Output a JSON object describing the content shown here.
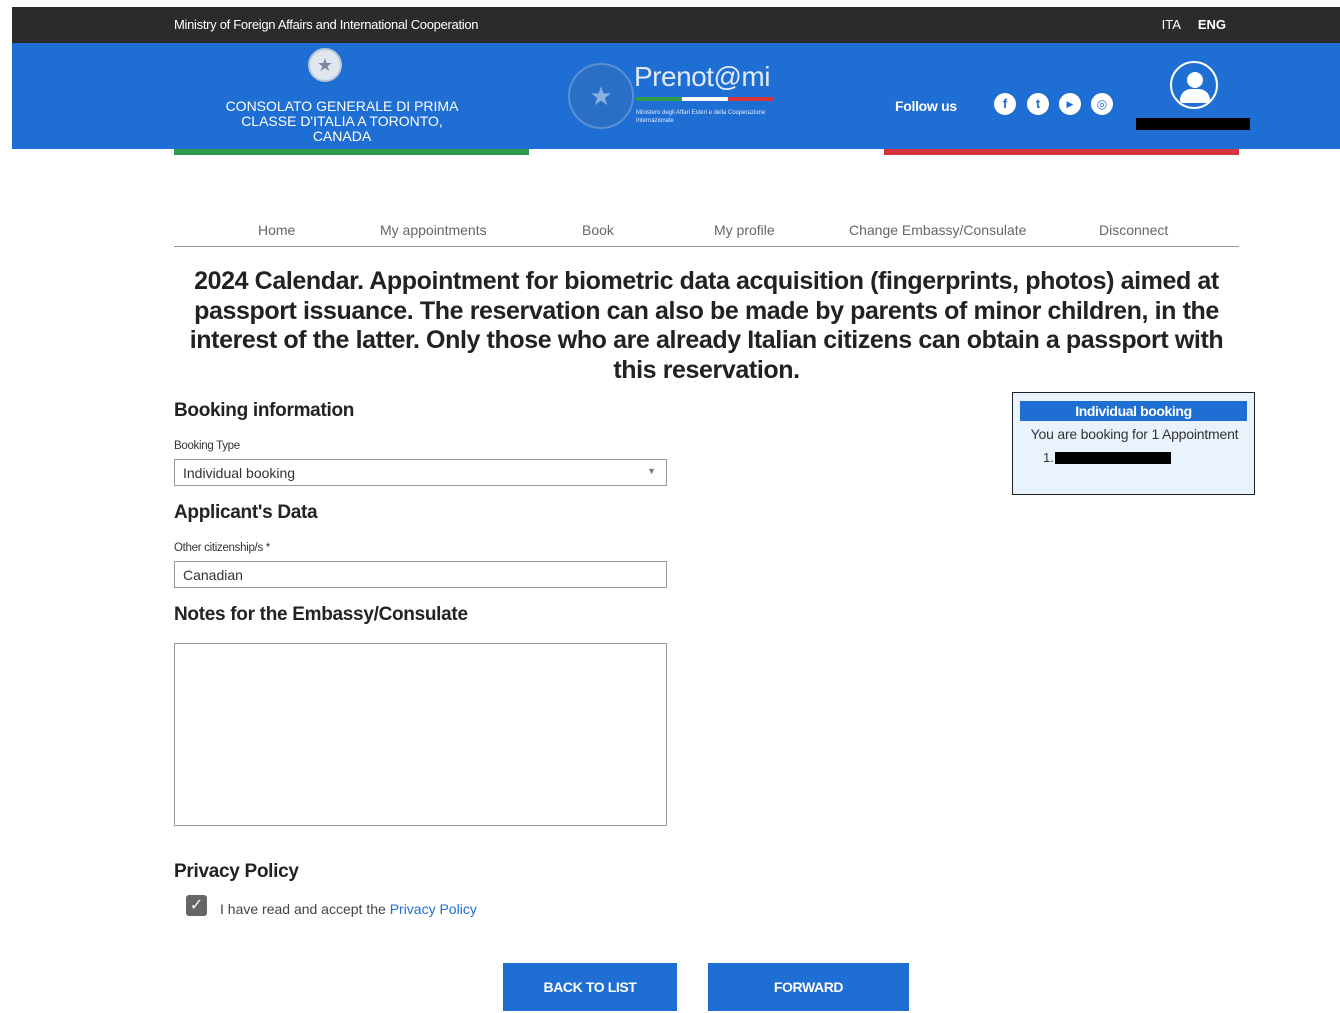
{
  "topbar": {
    "ministry": "Ministry of Foreign Affairs and International Cooperation",
    "lang_ita": "ITA",
    "lang_eng": "ENG"
  },
  "header": {
    "consulate": "CONSOLATO GENERALE DI PRIMA CLASSE D'ITALIA A TORONTO, CANADA",
    "prenot_title": "Prenot@mi",
    "prenot_sub": "Ministero degli Affari Esteri e della Cooperazione Internazionale",
    "follow_us": "Follow us",
    "social_icons": [
      "facebook-icon",
      "twitter-icon",
      "youtube-icon",
      "instagram-icon"
    ],
    "colors": {
      "blue": "#1f6ed4",
      "green": "#2e9a4b",
      "red": "#d6343f",
      "topbar": "#2b2b2b"
    }
  },
  "nav": {
    "items": [
      "Home",
      "My appointments",
      "Book",
      "My profile",
      "Change Embassy/Consulate",
      "Disconnect"
    ]
  },
  "headline": "2024 Calendar. Appointment for biometric data acquisition (fingerprints, photos) aimed at passport issuance. The reservation can also be made by parents of minor children, in the interest of the latter. Only those who are already Italian citizens can obtain a passport with this reservation.",
  "form": {
    "booking_info_title": "Booking information",
    "booking_type_label": "Booking Type",
    "booking_type_value": "Individual booking",
    "applicant_title": "Applicant's Data",
    "citizenship_label": "Other citizenship/s *",
    "citizenship_value": "Canadian",
    "notes_title": "Notes for the Embassy/Consulate",
    "notes_value": "",
    "privacy_title": "Privacy Policy",
    "privacy_text": "I have read and accept the ",
    "privacy_link": "Privacy Policy",
    "privacy_checked": true
  },
  "buttons": {
    "back": "BACK TO LIST",
    "forward": "FORWARD"
  },
  "summary": {
    "title": "Individual booking",
    "text": "You are booking for 1 Appointment",
    "item_number": "1."
  }
}
